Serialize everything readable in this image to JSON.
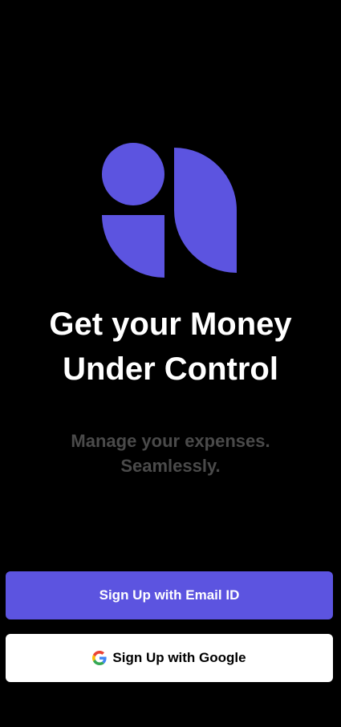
{
  "colors": {
    "background": "#000000",
    "accent": "#5c54e0",
    "subtitle": "#4a4a4a"
  },
  "logo": {
    "icon": "brand-logo-icon"
  },
  "headline": {
    "line1": "Get your Money",
    "line2": "Under Control"
  },
  "subtitle": {
    "line1": "Manage your expenses.",
    "line2": "Seamlessly."
  },
  "buttons": {
    "email_label": "Sign Up with Email ID",
    "google_label": "Sign Up with Google",
    "google_icon": "google-icon"
  }
}
